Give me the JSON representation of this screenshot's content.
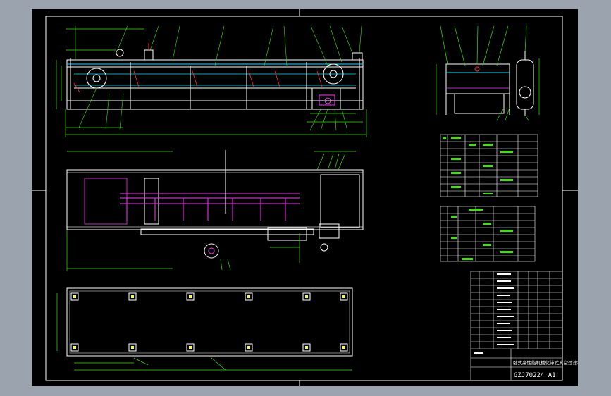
{
  "drawing": {
    "title": "卧式高性能机械化带式真空过滤机",
    "number": "GZJ70224 A1",
    "colors": {
      "background": "#000000",
      "frame": "#ffffff",
      "line": "#ffffff",
      "dimension": "#39e600",
      "accent_cyan": "#00e5ff",
      "accent_magenta": "#ff33ff",
      "accent_yellow": "#ffff33",
      "accent_red": "#ff3333",
      "outer_bg": "#9ba3ae"
    }
  }
}
